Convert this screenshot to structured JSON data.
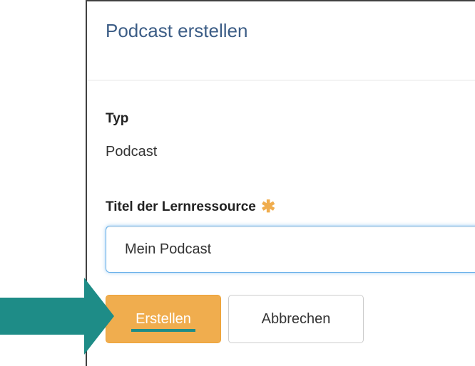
{
  "dialog": {
    "title": "Podcast erstellen"
  },
  "form": {
    "type_label": "Typ",
    "type_value": "Podcast",
    "title_label": "Titel der Lernressource",
    "required_marker": "✱",
    "title_value": "Mein Podcast"
  },
  "buttons": {
    "create_label": "Erstellen",
    "cancel_label": "Abbrechen"
  },
  "colors": {
    "title_text": "#3c5d86",
    "primary_button": "#f0ad4e",
    "annotation_arrow": "#1e8c87",
    "input_focus_border": "#66afe9"
  }
}
